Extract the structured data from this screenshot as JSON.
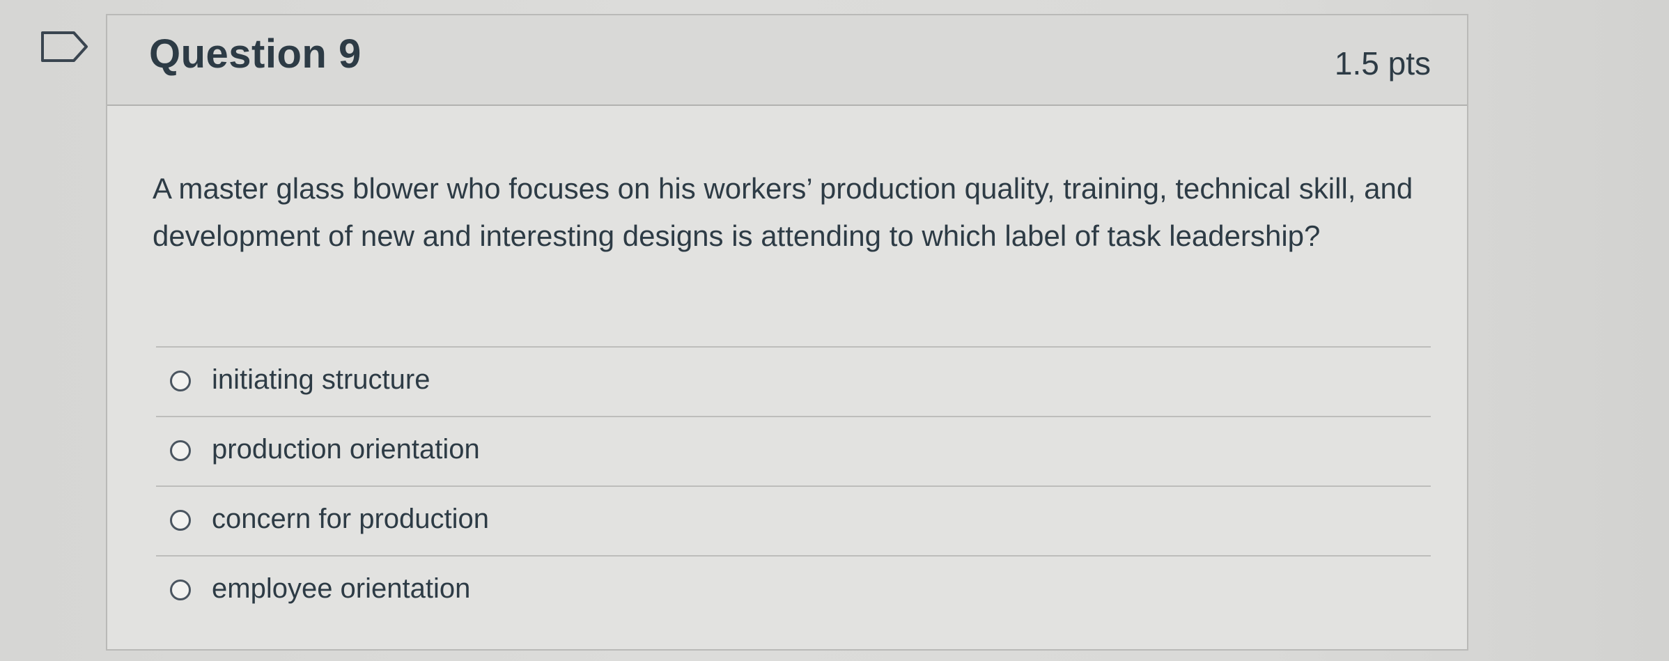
{
  "question": {
    "title": "Question 9",
    "points": "1.5 pts",
    "text": "A master glass blower who focuses on his workers’ production quality, training, technical skill, and development of new and interesting designs is attending to which label of task leadership?"
  },
  "answers": [
    {
      "label": "initiating structure",
      "selected": false
    },
    {
      "label": "production orientation",
      "selected": false
    },
    {
      "label": "concern for production",
      "selected": false
    },
    {
      "label": "employee orientation",
      "selected": false
    }
  ],
  "icons": {
    "flag": "bookmark-flag-icon"
  },
  "colors": {
    "text": "#2d3b45",
    "card_background": "#e2e2e0",
    "header_background": "#d9d9d7",
    "border": "#b9b9b7"
  }
}
